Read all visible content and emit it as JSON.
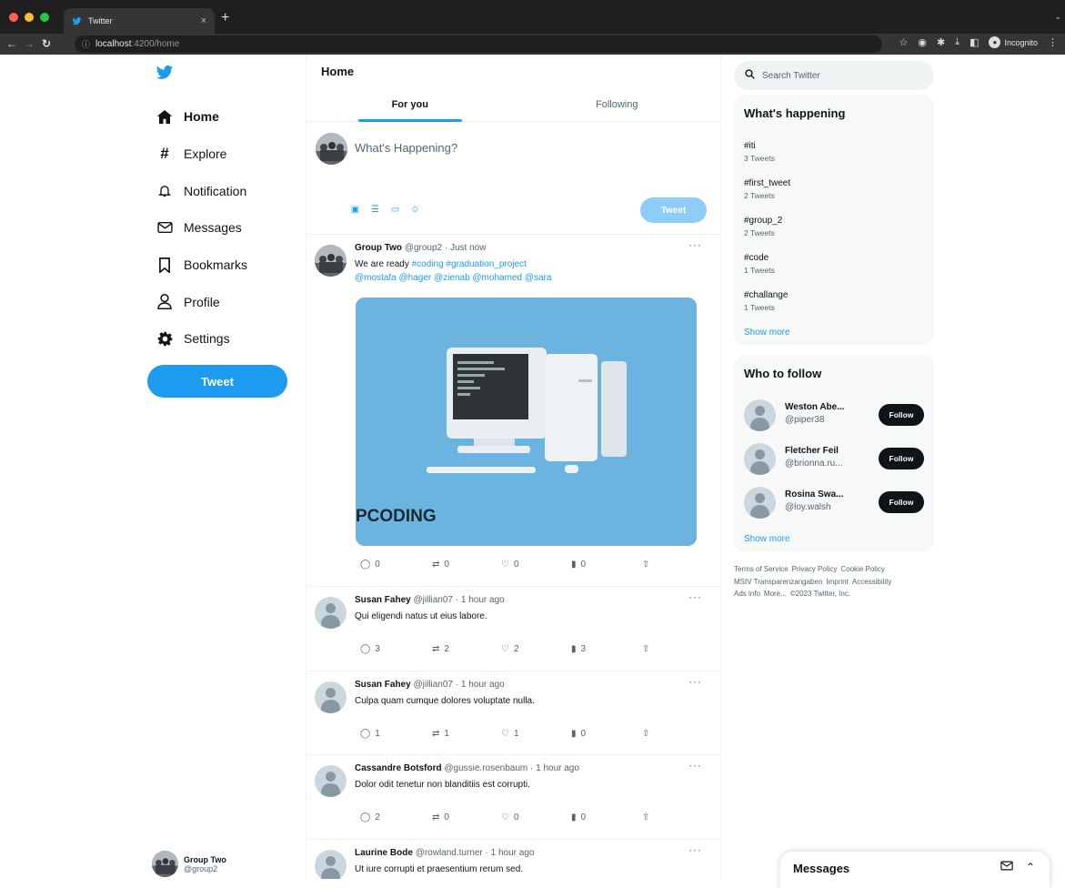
{
  "browser": {
    "tab_title": "Twitter",
    "tab_close": "×",
    "new_tab": "+",
    "url_host": "localhost",
    "url_path": ":4200/home",
    "incognito_label": "Incognito"
  },
  "sidebar": {
    "items": [
      {
        "label": "Home",
        "icon": "home-icon"
      },
      {
        "label": "Explore",
        "icon": "hashtag-icon"
      },
      {
        "label": "Notification",
        "icon": "bell-icon"
      },
      {
        "label": "Messages",
        "icon": "envelope-icon"
      },
      {
        "label": "Bookmarks",
        "icon": "bookmark-icon"
      },
      {
        "label": "Profile",
        "icon": "person-icon"
      },
      {
        "label": "Settings",
        "icon": "gear-icon"
      }
    ],
    "tweet_button": "Tweet",
    "account": {
      "name": "Group Two",
      "handle": "@group2"
    }
  },
  "feed": {
    "title": "Home",
    "tabs": [
      "For you",
      "Following"
    ],
    "compose": {
      "placeholder": "What's Happening?",
      "tweet_button": "Tweet"
    },
    "posts": [
      {
        "name": "Group Two",
        "handle": "@group2 · Just now",
        "text": "We are ready",
        "tags": "#coding #graduation_project",
        "mentions": "@mostafa @hager @zienab @mohamed @sara",
        "media_text": "PCODING",
        "replies": "0",
        "retweets": "0",
        "likes": "0",
        "views": "0"
      },
      {
        "name": "Susan Fahey",
        "handle": "@jillian07 · 1 hour ago",
        "text": "Qui eligendi natus ut eius labore.",
        "replies": "3",
        "retweets": "2",
        "likes": "2",
        "views": "3"
      },
      {
        "name": "Susan Fahey",
        "handle": "@jillian07 · 1 hour ago",
        "text": "Culpa quam cumque dolores voluptate nulla.",
        "replies": "1",
        "retweets": "1",
        "likes": "1",
        "views": "0"
      },
      {
        "name": "Cassandre Botsford",
        "handle": "@gussie.rosenbaum · 1 hour ago",
        "text": "Dolor odit tenetur non blanditiis est corrupti.",
        "replies": "2",
        "retweets": "0",
        "likes": "0",
        "views": "0"
      },
      {
        "name": "Laurine Bode",
        "handle": "@rowland.turner · 1 hour ago",
        "text": "Ut iure corrupti et praesentium rerum sed."
      }
    ]
  },
  "right": {
    "search_placeholder": "Search Twitter",
    "trends_title": "What's happening",
    "trends": [
      {
        "tag": "#iti",
        "count": "3 Tweets"
      },
      {
        "tag": "#first_tweet",
        "count": "2 Tweets"
      },
      {
        "tag": "#group_2",
        "count": "2 Tweets"
      },
      {
        "tag": "#code",
        "count": "1 Tweets"
      },
      {
        "tag": "#challange",
        "count": "1 Tweets"
      }
    ],
    "trends_show_more": "Show more",
    "follow_title": "Who to follow",
    "follow": [
      {
        "name": "Weston Abe...",
        "handle": "@piper38",
        "button": "Follow"
      },
      {
        "name": "Fletcher Feil",
        "handle": "@brionna.ru...",
        "button": "Follow"
      },
      {
        "name": "Rosina Swa...",
        "handle": "@loy.walsh",
        "button": "Follow"
      }
    ],
    "follow_show_more": "Show more",
    "footer": [
      "Terms of Service",
      "Privacy Policy",
      "Cookie Policy",
      "MStV Transparenzangaben",
      "Imprint",
      "Accessibility",
      "Ads info",
      "More...",
      "©2023 Twitter, Inc."
    ],
    "messages_title": "Messages"
  },
  "colors": {
    "accent": "#1d9bf0",
    "accent_disabled": "#8ecdf8",
    "text": "#0f1419",
    "muted": "#536471"
  }
}
